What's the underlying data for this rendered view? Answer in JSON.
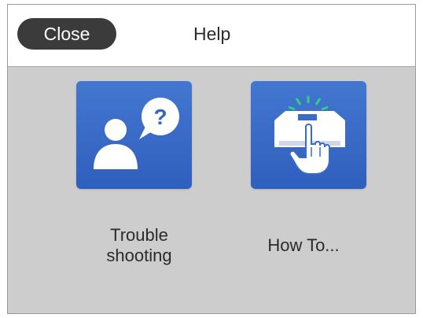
{
  "header": {
    "close_label": "Close",
    "title": "Help"
  },
  "tiles": [
    {
      "id": "trouble-shooting",
      "label_line1": "Trouble",
      "label_line2": "shooting",
      "icon": "person-question-icon"
    },
    {
      "id": "how-to",
      "label": "How To...",
      "icon": "hand-pressing-printer-icon"
    }
  ],
  "colors": {
    "tile_blue": "#3a6bc8",
    "close_button": "#3b3b3b",
    "background": "#cdcdcd",
    "accent_green": "#2fd07a"
  }
}
